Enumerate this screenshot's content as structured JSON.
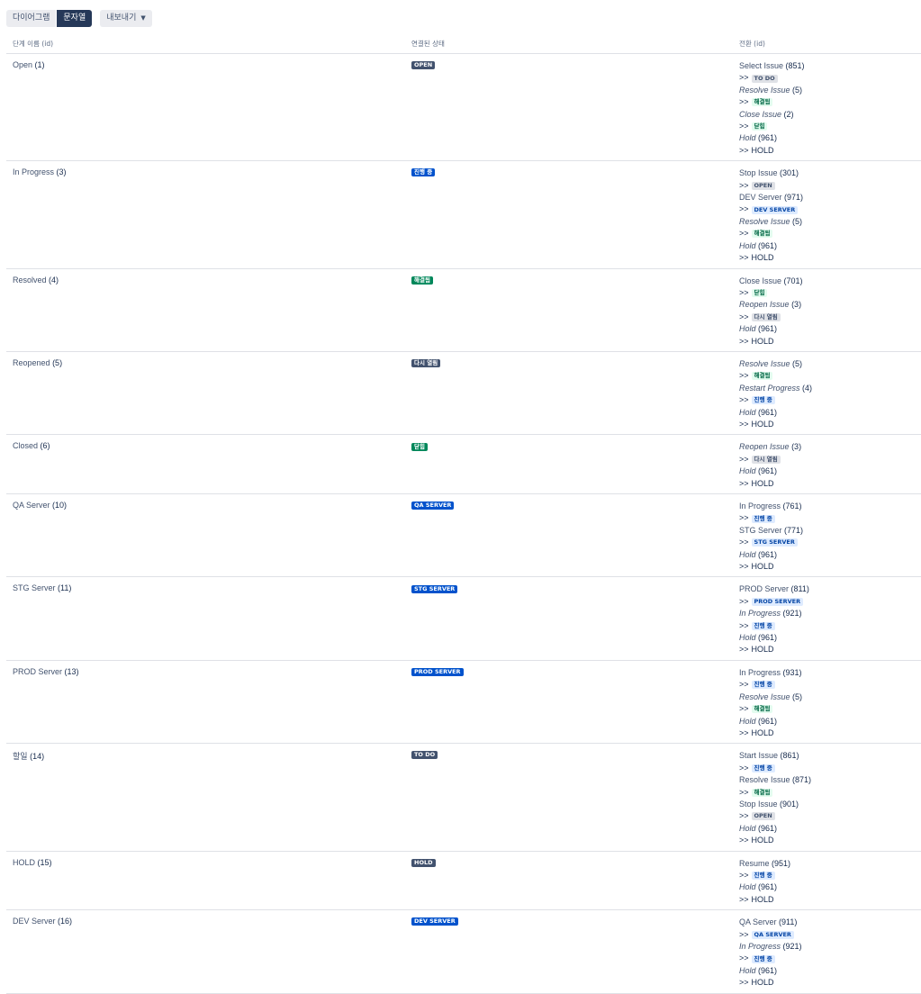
{
  "toolbar": {
    "diagram": "다이어그램",
    "text": "문자열",
    "export": "내보내기"
  },
  "headers": {
    "step": "단계 이름 (id)",
    "status": "연결된 상태",
    "transitions": "전환 (id)"
  },
  "rows": [
    {
      "name": "Open",
      "id": "(1)",
      "status": {
        "label": "OPEN",
        "style": "default"
      },
      "transitions": [
        {
          "name": "Select Issue",
          "italic": false,
          "id": "(851)",
          "target": {
            "label": "TO DO",
            "style": "default"
          }
        },
        {
          "name": "Resolve Issue",
          "italic": true,
          "id": "(5)",
          "target": {
            "label": "해결됨",
            "style": "green"
          }
        },
        {
          "name": "Close Issue",
          "italic": true,
          "id": "(2)",
          "target": {
            "label": "닫힘",
            "style": "green"
          }
        },
        {
          "name": "Hold",
          "italic": true,
          "id": "(961)",
          "target": {
            "label": "HOLD",
            "style": "plain"
          }
        }
      ]
    },
    {
      "name": "In Progress",
      "id": "(3)",
      "status": {
        "label": "진행 중",
        "style": "blue"
      },
      "transitions": [
        {
          "name": "Stop Issue",
          "italic": false,
          "id": "(301)",
          "target": {
            "label": "OPEN",
            "style": "default"
          }
        },
        {
          "name": "DEV Server",
          "italic": false,
          "id": "(971)",
          "target": {
            "label": "DEV SERVER",
            "style": "blue"
          }
        },
        {
          "name": "Resolve Issue",
          "italic": true,
          "id": "(5)",
          "target": {
            "label": "해결됨",
            "style": "green"
          }
        },
        {
          "name": "Hold",
          "italic": true,
          "id": "(961)",
          "target": {
            "label": "HOLD",
            "style": "plain"
          }
        }
      ]
    },
    {
      "name": "Resolved",
      "id": "(4)",
      "status": {
        "label": "해결됨",
        "style": "green"
      },
      "transitions": [
        {
          "name": "Close Issue",
          "italic": false,
          "id": "(701)",
          "target": {
            "label": "닫힘",
            "style": "green"
          }
        },
        {
          "name": "Reopen Issue",
          "italic": true,
          "id": "(3)",
          "target": {
            "label": "다시 열림",
            "style": "default"
          }
        },
        {
          "name": "Hold",
          "italic": true,
          "id": "(961)",
          "target": {
            "label": "HOLD",
            "style": "plain"
          }
        }
      ]
    },
    {
      "name": "Reopened",
      "id": "(5)",
      "status": {
        "label": "다시 열림",
        "style": "default"
      },
      "transitions": [
        {
          "name": "Resolve Issue",
          "italic": true,
          "id": "(5)",
          "target": {
            "label": "해결됨",
            "style": "green"
          }
        },
        {
          "name": "Restart Progress",
          "italic": true,
          "id": "(4)",
          "target": {
            "label": "진행 중",
            "style": "blue"
          }
        },
        {
          "name": "Hold",
          "italic": true,
          "id": "(961)",
          "target": {
            "label": "HOLD",
            "style": "plain"
          }
        }
      ]
    },
    {
      "name": "Closed",
      "id": "(6)",
      "status": {
        "label": "닫힘",
        "style": "green"
      },
      "transitions": [
        {
          "name": "Reopen Issue",
          "italic": true,
          "id": "(3)",
          "target": {
            "label": "다시 열림",
            "style": "default"
          }
        },
        {
          "name": "Hold",
          "italic": true,
          "id": "(961)",
          "target": {
            "label": "HOLD",
            "style": "plain"
          }
        }
      ]
    },
    {
      "name": "QA Server",
      "id": "(10)",
      "status": {
        "label": "QA SERVER",
        "style": "blue"
      },
      "transitions": [
        {
          "name": "In Progress",
          "italic": false,
          "id": "(761)",
          "target": {
            "label": "진행 중",
            "style": "blue"
          }
        },
        {
          "name": "STG Server",
          "italic": false,
          "id": "(771)",
          "target": {
            "label": "STG SERVER",
            "style": "blue"
          }
        },
        {
          "name": "Hold",
          "italic": true,
          "id": "(961)",
          "target": {
            "label": "HOLD",
            "style": "plain"
          }
        }
      ]
    },
    {
      "name": "STG Server",
      "id": "(11)",
      "status": {
        "label": "STG SERVER",
        "style": "blue"
      },
      "transitions": [
        {
          "name": "PROD Server",
          "italic": false,
          "id": "(811)",
          "target": {
            "label": "PROD SERVER",
            "style": "blue"
          }
        },
        {
          "name": "In Progress",
          "italic": true,
          "id": "(921)",
          "target": {
            "label": "진행 중",
            "style": "blue"
          }
        },
        {
          "name": "Hold",
          "italic": true,
          "id": "(961)",
          "target": {
            "label": "HOLD",
            "style": "plain"
          }
        }
      ]
    },
    {
      "name": "PROD Server",
      "id": "(13)",
      "status": {
        "label": "PROD SERVER",
        "style": "blue"
      },
      "transitions": [
        {
          "name": "In Progress",
          "italic": false,
          "id": "(931)",
          "target": {
            "label": "진행 중",
            "style": "blue"
          }
        },
        {
          "name": "Resolve Issue",
          "italic": true,
          "id": "(5)",
          "target": {
            "label": "해결됨",
            "style": "green"
          }
        },
        {
          "name": "Hold",
          "italic": true,
          "id": "(961)",
          "target": {
            "label": "HOLD",
            "style": "plain"
          }
        }
      ]
    },
    {
      "name": "할일",
      "id": "(14)",
      "status": {
        "label": "TO DO",
        "style": "default"
      },
      "transitions": [
        {
          "name": "Start Issue",
          "italic": false,
          "id": "(861)",
          "target": {
            "label": "진행 중",
            "style": "blue"
          }
        },
        {
          "name": "Resolve Issue",
          "italic": false,
          "id": "(871)",
          "target": {
            "label": "해결됨",
            "style": "green"
          }
        },
        {
          "name": "Stop Issue",
          "italic": false,
          "id": "(901)",
          "target": {
            "label": "OPEN",
            "style": "default"
          }
        },
        {
          "name": "Hold",
          "italic": true,
          "id": "(961)",
          "target": {
            "label": "HOLD",
            "style": "plain"
          }
        }
      ]
    },
    {
      "name": "HOLD",
      "id": "(15)",
      "status": {
        "label": "HOLD",
        "style": "default"
      },
      "transitions": [
        {
          "name": "Resume",
          "italic": false,
          "id": "(951)",
          "target": {
            "label": "진행 중",
            "style": "blue"
          }
        },
        {
          "name": "Hold",
          "italic": true,
          "id": "(961)",
          "target": {
            "label": "HOLD",
            "style": "plain"
          }
        }
      ]
    },
    {
      "name": "DEV Server",
      "id": "(16)",
      "status": {
        "label": "DEV SERVER",
        "style": "blue"
      },
      "transitions": [
        {
          "name": "QA Server",
          "italic": false,
          "id": "(911)",
          "target": {
            "label": "QA SERVER",
            "style": "blue"
          }
        },
        {
          "name": "In Progress",
          "italic": true,
          "id": "(921)",
          "target": {
            "label": "진행 중",
            "style": "blue"
          }
        },
        {
          "name": "Hold",
          "italic": true,
          "id": "(961)",
          "target": {
            "label": "HOLD",
            "style": "plain"
          }
        }
      ]
    }
  ],
  "arrow_text": ">>"
}
